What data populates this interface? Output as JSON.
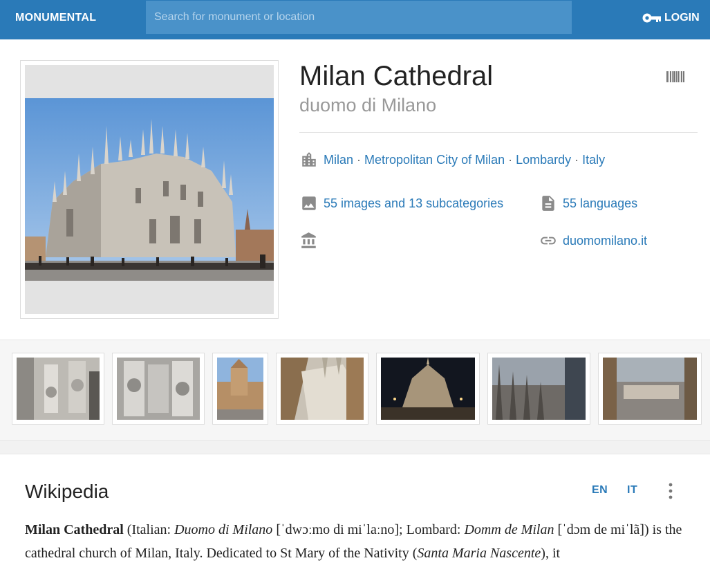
{
  "header": {
    "brand": "MONUMENTAL",
    "search_placeholder": "Search for monument or location",
    "login_label": "LOGIN"
  },
  "monument": {
    "title": "Milan Cathedral",
    "subtitle": "duomo di Milano",
    "location": [
      "Milan",
      "Metropolitan City of Milan",
      "Lombardy",
      "Italy"
    ],
    "location_separator": "·",
    "commons": "55 images and 13 subcategories",
    "languages": "55 languages",
    "website": "duomomilano.it"
  },
  "wikipedia": {
    "heading": "Wikipedia",
    "languages": [
      "EN",
      "IT"
    ],
    "paragraph": [
      {
        "t": "Milan Cathedral",
        "s": "b"
      },
      {
        "t": " (Italian: ",
        "s": ""
      },
      {
        "t": "Duomo di Milano",
        "s": "i"
      },
      {
        "t": " [ˈdwɔːmo di miˈlaːno]; Lombard: ",
        "s": ""
      },
      {
        "t": "Domm de Milan",
        "s": "i"
      },
      {
        "t": " [ˈdɔm de miˈlã]) is the cathedral church of Milan, Italy. Dedicated to St Mary of the Nativity (",
        "s": ""
      },
      {
        "t": "Santa Maria Nascente",
        "s": "i"
      },
      {
        "t": "), it",
        "s": ""
      }
    ]
  },
  "icons": {
    "login": "key-icon",
    "barcode": "barcode-icon",
    "location": "city-icon",
    "commons": "image-icon",
    "languages": "document-icon",
    "heritage": "museum-icon",
    "website": "link-icon",
    "more": "more-vertical-icon"
  },
  "colors": {
    "header_bg": "#2a7ab8",
    "link": "#2a7ab8",
    "muted": "#999999"
  }
}
